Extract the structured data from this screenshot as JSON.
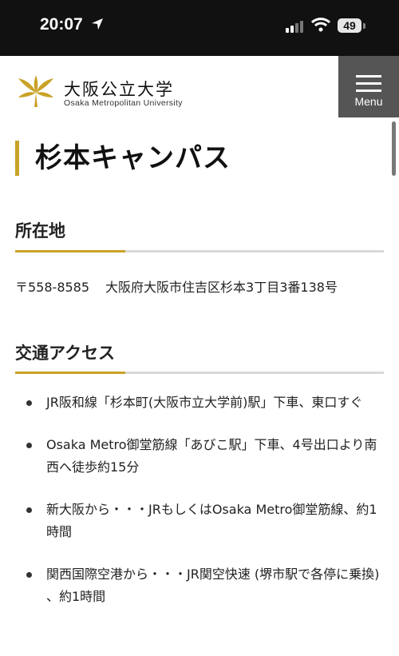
{
  "status_bar": {
    "time": "20:07",
    "battery": "49"
  },
  "header": {
    "university_name_ja": "大阪公立大学",
    "university_name_en": "Osaka Metropolitan University",
    "menu_label": "Menu"
  },
  "page": {
    "title": "杉本キャンパス"
  },
  "location": {
    "heading": "所在地",
    "postal_code": "〒558-8585",
    "address": "大阪府大阪市住吉区杉本3丁目3番138号"
  },
  "access": {
    "heading": "交通アクセス",
    "items": [
      "JR阪和線「杉本町(大阪市立大学前)駅」下車、東口すぐ",
      "Osaka Metro御堂筋線「あびこ駅」下車、4号出口より南西へ徒歩約15分",
      "新大阪から・・・JRもしくはOsaka Metro御堂筋線、約1時間",
      "関西国際空港から・・・JR関空快速 (堺市駅で各停に乗換) 、約1時間"
    ]
  },
  "colors": {
    "accent_gold": "#c9a227",
    "status_bar_bg": "#111111",
    "menu_bg": "#555555"
  }
}
